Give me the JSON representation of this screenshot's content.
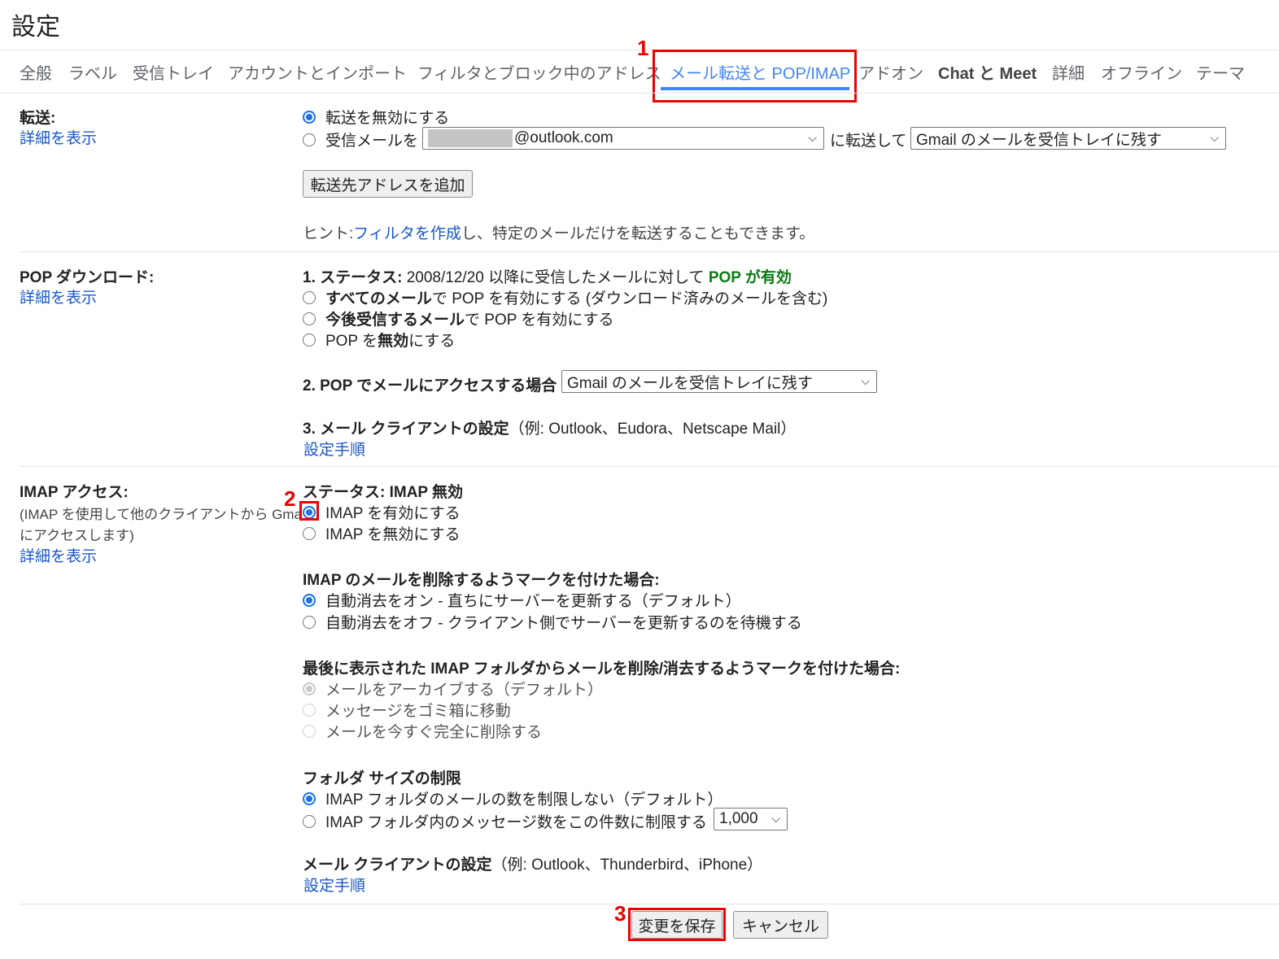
{
  "page_title": "設定",
  "tabs": [
    {
      "label": "全般"
    },
    {
      "label": "ラベル"
    },
    {
      "label": "受信トレイ"
    },
    {
      "label": "アカウントとインポート"
    },
    {
      "label": "フィルタとブロック中のアドレス"
    },
    {
      "label": "メール転送と POP/IMAP",
      "active": true
    },
    {
      "label": "アドオン"
    },
    {
      "label": "Chat と Meet"
    },
    {
      "label": "詳細"
    },
    {
      "label": "オフライン"
    },
    {
      "label": "テーマ"
    }
  ],
  "annotations": {
    "step1": "1",
    "step2": "2",
    "step3": "3"
  },
  "forwarding": {
    "label": "転送:",
    "details_link": "詳細を表示",
    "option_disable": "転送を無効にする",
    "option_forward_prefix": "受信メールを",
    "address_suffix": "@outlook.com",
    "forward_middle": "に転送して",
    "action_select": "Gmail のメールを受信トレイに残す",
    "add_address_button": "転送先アドレスを追加",
    "hint_prefix": "ヒント: ",
    "hint_link": "フィルタを作成",
    "hint_suffix": "し、特定のメールだけを転送することもできます。"
  },
  "pop": {
    "label": "POP ダウンロード:",
    "details_link": "詳細を表示",
    "status_label": "1. ステータス:",
    "status_text": " 2008/12/20 以降に受信したメールに対して ",
    "status_value": "POP が有効",
    "opt1_bold": "すべてのメール",
    "opt1_rest": "で POP を有効にする (ダウンロード済みのメールを含む)",
    "opt2_bold": "今後受信するメール",
    "opt2_rest": "で POP を有効にする",
    "opt3_pre": "POP を",
    "opt3_bold": "無効",
    "opt3_post": "にする",
    "access_label": "2. POP でメールにアクセスする場合",
    "access_select": "Gmail のメールを受信トレイに残す",
    "client_label": "3. メール クライアントの設定",
    "client_examples": "（例: Outlook、Eudora、Netscape Mail）",
    "client_link": "設定手順"
  },
  "imap": {
    "label": "IMAP アクセス:",
    "desc_line1": "(IMAP を使用して他のクライアントから Gmail",
    "desc_line2": "にアクセスします)",
    "details_link": "詳細を表示",
    "status": "ステータス: IMAP 無効",
    "enable": "IMAP を有効にする",
    "disable": "IMAP を無効にする",
    "expunge_heading": "IMAP のメールを削除するようマークを付けた場合:",
    "expunge_on": "自動消去をオン - 直ちにサーバーを更新する（デフォルト）",
    "expunge_off": "自動消去をオフ - クライアント側でサーバーを更新するのを待機する",
    "deleted_heading": "最後に表示された IMAP フォルダからメールを削除/消去するようマークを付けた場合:",
    "deleted_archive": "メールをアーカイブする（デフォルト）",
    "deleted_trash": "メッセージをゴミ箱に移動",
    "deleted_delete": "メールを今すぐ完全に削除する",
    "folder_heading": "フォルダ サイズの制限",
    "folder_unlimited": "IMAP フォルダのメールの数を制限しない（デフォルト）",
    "folder_limit": "IMAP フォルダ内のメッセージ数をこの件数に制限する",
    "folder_limit_value": "1,000",
    "client_label": "メール クライアントの設定",
    "client_examples": "（例: Outlook、Thunderbird、iPhone）",
    "client_link": "設定手順"
  },
  "footer": {
    "save": "変更を保存",
    "cancel": "キャンセル"
  }
}
